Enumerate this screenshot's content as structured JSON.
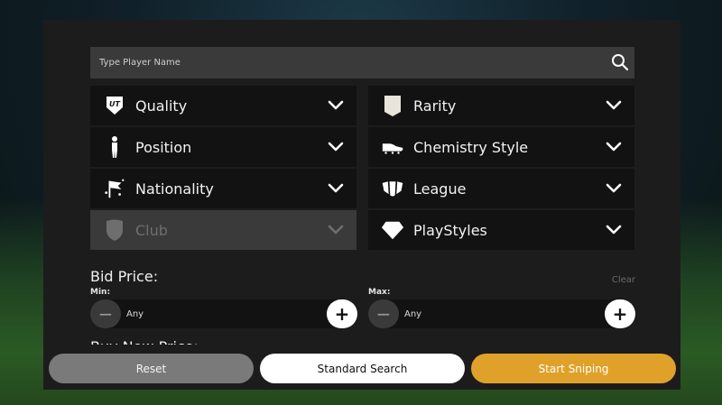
{
  "search": {
    "placeholder": "Type Player Name"
  },
  "filters_left": [
    {
      "label": "Quality",
      "icon": "ut-badge-icon",
      "enabled": true
    },
    {
      "label": "Position",
      "icon": "player-figure-icon",
      "enabled": true
    },
    {
      "label": "Nationality",
      "icon": "flags-icon",
      "enabled": true
    },
    {
      "label": "Club",
      "icon": "club-crest-icon",
      "enabled": false
    }
  ],
  "filters_right": [
    {
      "label": "Rarity",
      "icon": "card-icon",
      "enabled": true
    },
    {
      "label": "Chemistry Style",
      "icon": "boot-icon",
      "enabled": true
    },
    {
      "label": "League",
      "icon": "league-icon",
      "enabled": true
    },
    {
      "label": "PlayStyles",
      "icon": "diamond-icon",
      "enabled": true
    }
  ],
  "bid_price": {
    "title": "Bid Price:",
    "clear_label": "Clear",
    "min_label": "Min:",
    "max_label": "Max:",
    "min_value": "Any",
    "max_value": "Any",
    "minus_symbol": "−",
    "plus_symbol": "+"
  },
  "buy_now": {
    "title": "Buy Now Price:"
  },
  "actions": {
    "reset": "Reset",
    "standard_search": "Standard Search",
    "start_sniping": "Start Sniping"
  },
  "colors": {
    "accent": "#e0a12a",
    "panel": "#1c1c1c",
    "filter_bg": "#121212",
    "disabled_bg": "#3a3a3a"
  }
}
